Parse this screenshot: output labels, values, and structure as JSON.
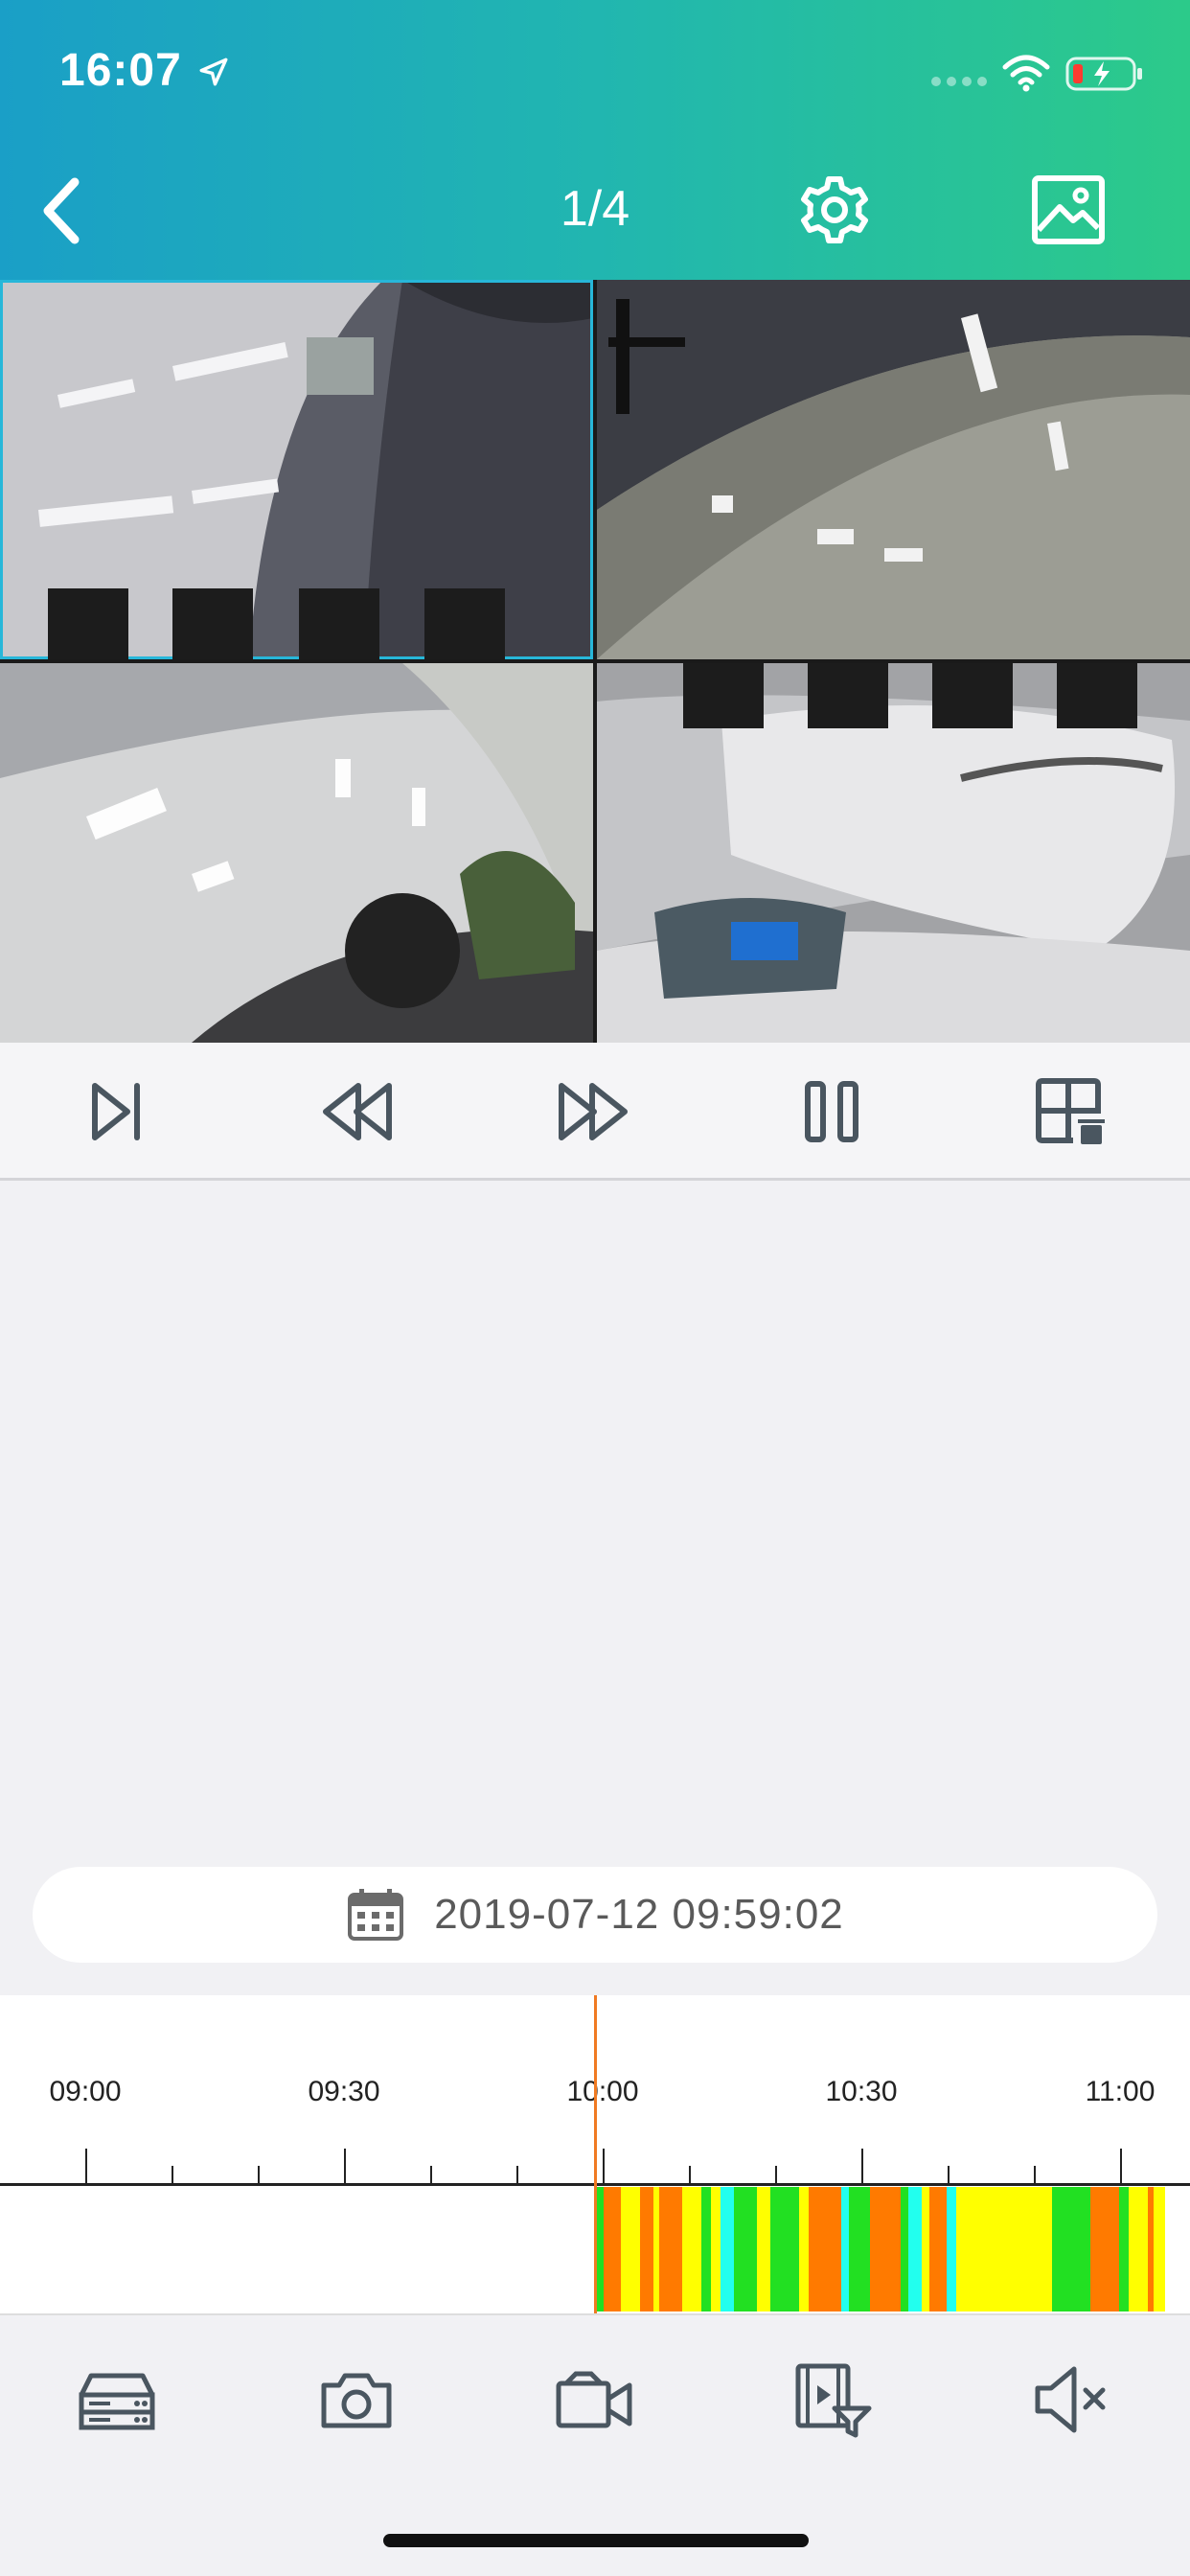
{
  "status_bar": {
    "time": "16:07"
  },
  "header": {
    "page_indicator": "1/4"
  },
  "playback": {
    "datetime": "2019-07-12 09:59:02"
  },
  "timeline": {
    "labels": [
      "09:00",
      "09:30",
      "10:00",
      "10:30",
      "11:00"
    ]
  },
  "icons": {
    "back": "chevron-left-icon",
    "settings": "gear-icon",
    "gallery": "image-icon",
    "controls": [
      "step-frame-icon",
      "rewind-icon",
      "fast-forward-icon",
      "pause-icon",
      "layout-grid-icon"
    ],
    "toolbar": [
      "dvr-device-icon",
      "camera-icon",
      "video-record-icon",
      "video-filter-icon",
      "mute-icon"
    ]
  },
  "colors": {
    "header_start": "#1a9fc7",
    "header_end": "#2cca8a",
    "cursor": "#f07a22",
    "record_green": "#22e022",
    "record_orange": "#ff7a00",
    "record_yellow": "#ffff00",
    "record_cyan": "#22ffee"
  }
}
